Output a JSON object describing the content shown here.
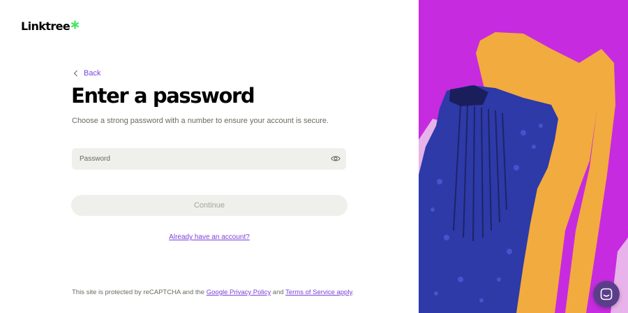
{
  "brand": {
    "name": "Linktree",
    "accent": "#7c41d8",
    "logo_star_color": "#43e55e"
  },
  "nav": {
    "back_label": "Back"
  },
  "form": {
    "title": "Enter a password",
    "subtitle": "Choose a strong password with a number to ensure your account is secure.",
    "password": {
      "placeholder": "Password",
      "value": "",
      "reveal_icon": "eye-icon"
    },
    "continue_label": "Continue",
    "continue_enabled": false,
    "login_link": "Already have an account?"
  },
  "footer": {
    "recaptcha_prefix": "This site is protected by reCAPTCHA and the ",
    "privacy_link": "Google Privacy Policy",
    "and_text": " and ",
    "terms_link": "Terms of Service apply",
    "suffix": "."
  },
  "hero": {
    "background": "#c62be0",
    "shape_color": "#f2ab3e",
    "lilac_color": "#e7b3ea",
    "figure_color": "#2d3aa8"
  },
  "chat": {
    "icon": "chat-icon",
    "background": "#5b3e8a"
  }
}
